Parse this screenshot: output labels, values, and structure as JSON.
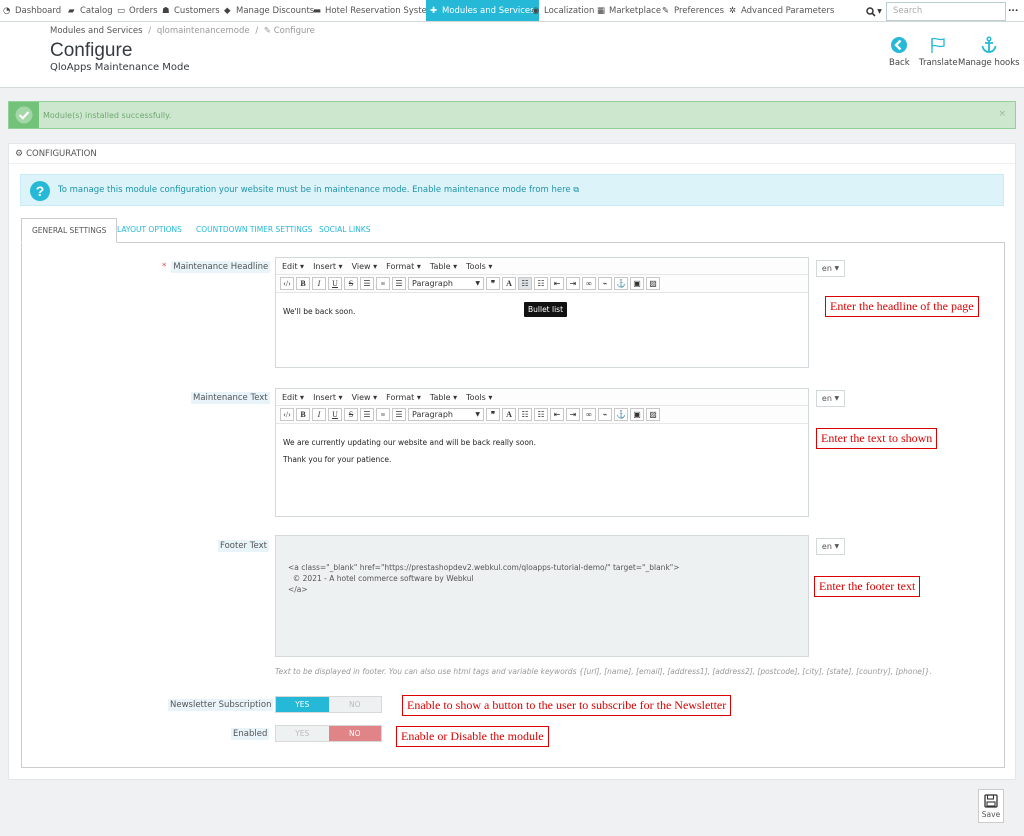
{
  "topnav": {
    "items": [
      {
        "label": "Dashboard",
        "icon": "dashboard-icon"
      },
      {
        "label": "Catalog",
        "icon": "book-icon"
      },
      {
        "label": "Orders",
        "icon": "credit-card-icon"
      },
      {
        "label": "Customers",
        "icon": "users-icon"
      },
      {
        "label": "Manage Discounts",
        "icon": "tag-icon"
      },
      {
        "label": "Hotel Reservation System",
        "icon": "bed-icon"
      },
      {
        "label": "Modules and Services",
        "icon": "puzzle-icon",
        "active": true
      },
      {
        "label": "Localization",
        "icon": "globe-icon"
      },
      {
        "label": "Marketplace",
        "icon": "shop-icon"
      },
      {
        "label": "Preferences",
        "icon": "wrench-icon"
      },
      {
        "label": "Advanced Parameters",
        "icon": "cogs-icon"
      }
    ],
    "search_placeholder": "Search",
    "more": "..."
  },
  "header": {
    "breadcrumb": {
      "root": "Modules and Services",
      "sep": "/",
      "module": "qlomaintenancemode",
      "current": "Configure"
    },
    "title": "Configure",
    "subtitle": "QloApps Maintenance Mode",
    "toolbar": [
      {
        "label": "Back",
        "icon": "back-icon"
      },
      {
        "label": "Translate",
        "icon": "flag-icon"
      },
      {
        "label": "Manage hooks",
        "icon": "anchor-icon"
      }
    ]
  },
  "alert": {
    "text": "Module(s) installed successfully.",
    "close": "×"
  },
  "panel": {
    "heading": "CONFIGURATION",
    "info": "To manage this module configuration your website must be in maintenance mode. Enable maintenance mode from here",
    "tabs": [
      "GENERAL SETTINGS",
      "LAYOUT OPTIONS",
      "COUNTDOWN TIMER SETTINGS",
      "SOCIAL LINKS"
    ]
  },
  "editor_ui": {
    "menus": [
      "Edit",
      "Insert",
      "View",
      "Format",
      "Table",
      "Tools"
    ],
    "format": "Paragraph",
    "tooltip": "Bullet list",
    "lang": "en"
  },
  "fields": {
    "headline": {
      "label": "Maintenance Headline",
      "required": "*",
      "content": "We'll be back soon."
    },
    "text": {
      "label": "Maintenance Text",
      "line1": "We are currently updating our website and will be back really soon.",
      "line2": "Thank you for your patience."
    },
    "footer": {
      "label": "Footer Text",
      "content": "<a class=\"_blank\" href=\"https://prestashopdev2.webkul.com/qloapps-tutorial-demo/\" target=\"_blank\">\n  © 2021 - A hotel commerce software by Webkul\n</a>",
      "help": "Text to be displayed in footer. You can also use html tags and variable keywords {[url], [name], [email], [address1], [address2], [postcode], [city], [state], [country], [phone]}."
    },
    "newsletter": {
      "label": "Newsletter Subscription",
      "yes": "YES",
      "no": "NO",
      "value": "YES"
    },
    "enabled": {
      "label": "Enabled",
      "yes": "YES",
      "no": "NO",
      "value": "NO"
    }
  },
  "callouts": {
    "headline": "Enter the headline of the page",
    "text": "Enter the text to shown",
    "footer": "Enter the footer text",
    "newsletter": "Enable to show a button to the user to subscribe for the Newsletter",
    "enabled": "Enable or Disable the module"
  },
  "save": "Save"
}
